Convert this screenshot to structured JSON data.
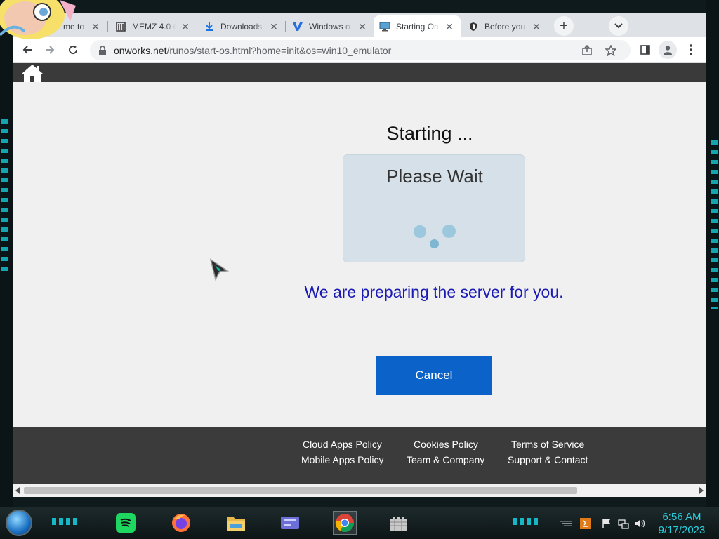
{
  "browser": {
    "tabs": [
      {
        "title": "me to",
        "icon": "page-icon"
      },
      {
        "title": "MEMZ 4.0 C",
        "icon": "archive-icon"
      },
      {
        "title": "Downloads",
        "icon": "download-icon"
      },
      {
        "title": "Windows o",
        "icon": "v-logo-icon"
      },
      {
        "title": "Starting On",
        "icon": "monitor-icon",
        "active": true
      },
      {
        "title": "Before you",
        "icon": "shield-icon"
      }
    ],
    "url_host": "onworks.net",
    "url_path": "/runos/start-os.html?home=init&os=win10_emulator"
  },
  "page": {
    "starting_title": "Starting ...",
    "wait_text": "Please Wait",
    "preparing_text": "We are preparing the server for you.",
    "cancel_label": "Cancel",
    "footer": {
      "cloud_apps_policy": "Cloud Apps Policy",
      "cookies_policy": "Cookies Policy",
      "terms_of_service": "Terms of Service",
      "mobile_apps_policy": "Mobile Apps Policy",
      "team_company": "Team & Company",
      "support_contact": "Support & Contact"
    }
  },
  "taskbar": {
    "apps": [
      "spotify",
      "firefox",
      "file-explorer",
      "media-player",
      "chrome",
      "castle-app"
    ],
    "time": "6:56 AM",
    "date": "9/17/2023"
  },
  "colors": {
    "preparing_text": "#1a1ab5",
    "cancel_button": "#0b63c9",
    "clock": "#2ad0e0"
  }
}
